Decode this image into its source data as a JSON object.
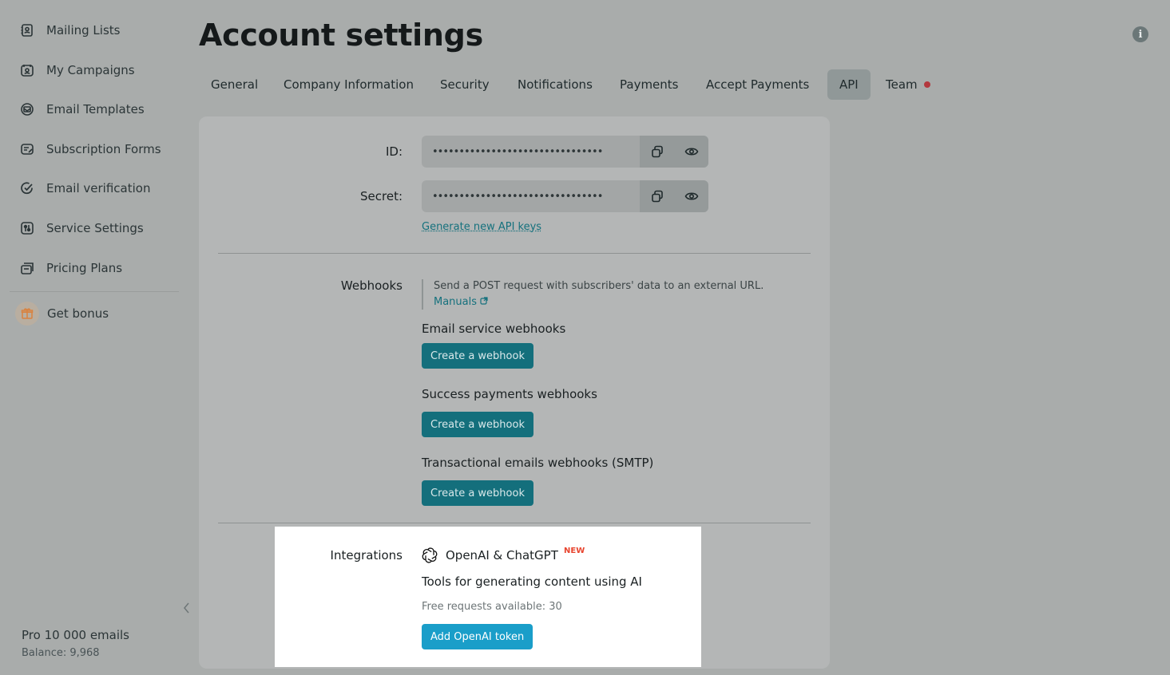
{
  "sidebar": {
    "items": [
      {
        "label": "Mailing Lists",
        "icon": "contacts-book-icon"
      },
      {
        "label": "My Campaigns",
        "icon": "campaigns-icon"
      },
      {
        "label": "Email Templates",
        "icon": "templates-icon"
      },
      {
        "label": "Subscription Forms",
        "icon": "forms-icon"
      },
      {
        "label": "Email verification",
        "icon": "check-circle-icon"
      },
      {
        "label": "Service Settings",
        "icon": "settings-icon"
      },
      {
        "label": "Pricing Plans",
        "icon": "pricing-icon"
      }
    ],
    "bonus": {
      "label": "Get bonus",
      "icon": "gift-icon"
    },
    "plan": "Pro 10 000 emails",
    "balance": "Balance: 9,968"
  },
  "header": {
    "title": "Account settings",
    "tabs": [
      {
        "label": "General"
      },
      {
        "label": "Company Information"
      },
      {
        "label": "Security"
      },
      {
        "label": "Notifications"
      },
      {
        "label": "Payments"
      },
      {
        "label": "Accept Payments"
      },
      {
        "label": "API",
        "active": true
      },
      {
        "label": "Team",
        "has_dot": true
      }
    ]
  },
  "api": {
    "id_label": "ID:",
    "id_value": "••••••••••••••••••••••••••••••••",
    "secret_label": "Secret:",
    "secret_value": "••••••••••••••••••••••••••••••••",
    "generate_link": "Generate new API keys"
  },
  "webhooks": {
    "label": "Webhooks",
    "hint": "Send a POST request with subscribers' data to an external URL.",
    "manuals": "Manuals",
    "sections": [
      {
        "title": "Email service webhooks",
        "button": "Create a webhook"
      },
      {
        "title": "Success payments webhooks",
        "button": "Create a webhook"
      },
      {
        "title": "Transactional emails webhooks (SMTP)",
        "button": "Create a webhook"
      }
    ]
  },
  "integrations": {
    "label": "Integrations",
    "name": "OpenAI & ChatGPT",
    "badge": "NEW",
    "description": "Tools for generating content using AI",
    "free_requests": "Free requests available: 30",
    "button": "Add OpenAI token"
  },
  "colors": {
    "accent": "#146f7c",
    "bright_button": "#1a9ec9",
    "badge": "#e8452f",
    "team_dot": "#b3383e"
  }
}
